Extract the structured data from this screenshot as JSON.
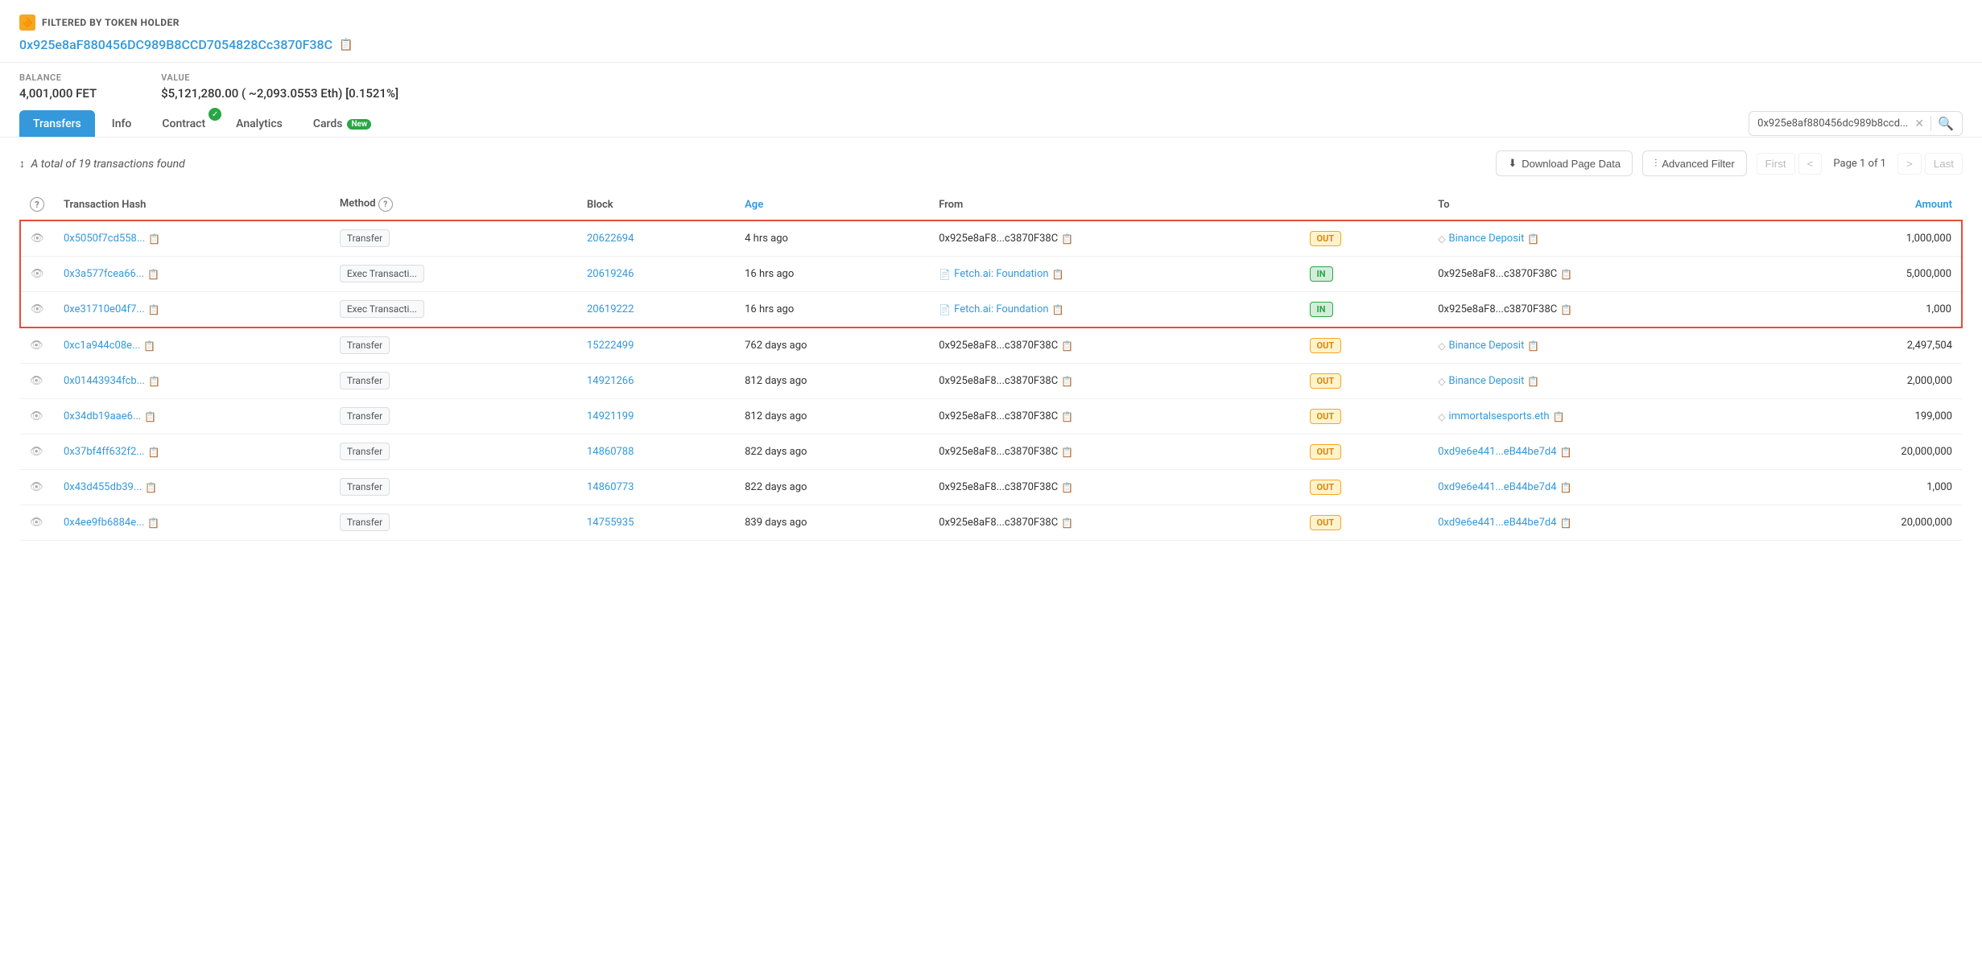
{
  "header": {
    "filter_icon": "🔶",
    "filter_label": "FILTERED BY TOKEN HOLDER",
    "address": "0x925e8aF880456DC989B8CCD7054828Cc3870F38C",
    "address_short": "0x925e8aF880456DC989B8CCD7054828Cc3870F38C",
    "copy_label": "📋"
  },
  "balance": {
    "label": "BALANCE",
    "value": "4,001,000 FET"
  },
  "value": {
    "label": "VALUE",
    "value": "$5,121,280.00 ( ~2,093.0553 Eth) [0.1521%]"
  },
  "tabs": [
    {
      "id": "transfers",
      "label": "Transfers",
      "active": true,
      "check": false,
      "badge": null
    },
    {
      "id": "info",
      "label": "Info",
      "active": false,
      "check": false,
      "badge": null
    },
    {
      "id": "contract",
      "label": "Contract",
      "active": false,
      "check": true,
      "badge": null
    },
    {
      "id": "analytics",
      "label": "Analytics",
      "active": false,
      "check": false,
      "badge": null
    },
    {
      "id": "cards",
      "label": "Cards",
      "active": false,
      "check": false,
      "badge": "New"
    }
  ],
  "search": {
    "value": "0x925e8af880456dc989b8ccd...",
    "placeholder": "Search"
  },
  "toolbar": {
    "total_label": "A total of 19 transactions found",
    "download_label": "Download Page Data",
    "filter_label": "Advanced Filter",
    "pagination": {
      "first": "First",
      "last": "Last",
      "prev": "<",
      "next": ">",
      "page_info": "Page 1 of 1"
    }
  },
  "table": {
    "columns": [
      "",
      "Transaction Hash",
      "Method",
      "Block",
      "Age",
      "From",
      "",
      "To",
      "Amount"
    ],
    "rows": [
      {
        "highlighted": true,
        "eye": "👁",
        "tx_hash": "0x5050f7cd558...",
        "method": "Transfer",
        "block": "20622694",
        "age": "4 hrs ago",
        "from": "0x925e8aF8...c3870F38C",
        "direction": "OUT",
        "to": "Binance Deposit",
        "to_icon": "◇",
        "to_link": true,
        "amount": "1,000,000"
      },
      {
        "highlighted": true,
        "eye": "👁",
        "tx_hash": "0x3a577fcea66...",
        "method": "Exec Transacti...",
        "block": "20619246",
        "age": "16 hrs ago",
        "from": "Fetch.ai: Foundation",
        "from_icon": "📄",
        "from_link": true,
        "direction": "IN",
        "to": "0x925e8aF8...c3870F38C",
        "amount": "5,000,000"
      },
      {
        "highlighted": true,
        "eye": "👁",
        "tx_hash": "0xe31710e04f7...",
        "method": "Exec Transacti...",
        "block": "20619222",
        "age": "16 hrs ago",
        "from": "Fetch.ai: Foundation",
        "from_icon": "📄",
        "from_link": true,
        "direction": "IN",
        "to": "0x925e8aF8...c3870F38C",
        "amount": "1,000"
      },
      {
        "highlighted": false,
        "eye": "👁",
        "tx_hash": "0xc1a944c08e...",
        "method": "Transfer",
        "block": "15222499",
        "age": "762 days ago",
        "from": "0x925e8aF8...c3870F38C",
        "direction": "OUT",
        "to": "Binance Deposit",
        "to_icon": "◇",
        "to_link": true,
        "amount": "2,497,504"
      },
      {
        "highlighted": false,
        "eye": "👁",
        "tx_hash": "0x01443934fcb...",
        "method": "Transfer",
        "block": "14921266",
        "age": "812 days ago",
        "from": "0x925e8aF8...c3870F38C",
        "direction": "OUT",
        "to": "Binance Deposit",
        "to_icon": "◇",
        "to_link": true,
        "amount": "2,000,000"
      },
      {
        "highlighted": false,
        "eye": "👁",
        "tx_hash": "0x34db19aae6...",
        "method": "Transfer",
        "block": "14921199",
        "age": "812 days ago",
        "from": "0x925e8aF8...c3870F38C",
        "direction": "OUT",
        "to": "immortalsesports.eth",
        "to_icon": "◇",
        "to_link": true,
        "amount": "199,000"
      },
      {
        "highlighted": false,
        "eye": "👁",
        "tx_hash": "0x37bf4ff632f2...",
        "method": "Transfer",
        "block": "14860788",
        "age": "822 days ago",
        "from": "0x925e8aF8...c3870F38C",
        "direction": "OUT",
        "to": "0xd9e6e441...eB44be7d4",
        "to_link": true,
        "amount": "20,000,000"
      },
      {
        "highlighted": false,
        "eye": "👁",
        "tx_hash": "0x43d455db39...",
        "method": "Transfer",
        "block": "14860773",
        "age": "822 days ago",
        "from": "0x925e8aF8...c3870F38C",
        "direction": "OUT",
        "to": "0xd9e6e441...eB44be7d4",
        "to_link": true,
        "amount": "1,000"
      },
      {
        "highlighted": false,
        "eye": "👁",
        "tx_hash": "0x4ee9fb6884e...",
        "method": "Transfer",
        "block": "14755935",
        "age": "839 days ago",
        "from": "0x925e8aF8...c3870F38C",
        "direction": "OUT",
        "to": "0xd9e6e441...eB44be7d4",
        "to_link": true,
        "amount": "20,000,000"
      }
    ]
  }
}
